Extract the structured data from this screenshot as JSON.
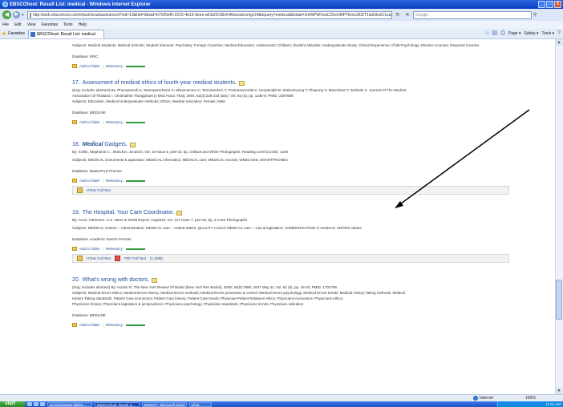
{
  "window": {
    "title": "EBSCOhost: Result List: medical - Windows Internet Explorer",
    "min": "_",
    "max": "□",
    "close": "x"
  },
  "address": {
    "url": "http://web.ebscohost.com/ehost/resultsadvanced?vid=13&hid=9&sid=b7025ef0-2215-4b13-9eee-a51b0316b%40sessionmgr14&bquery=medical&bdata=JmRiPWVoaCZ0eXBlPTEmc2l0ZT1laG9zdC1saXZl",
    "search_placeholder": "Google",
    "back": "◀",
    "forward": "▶",
    "refresh": "↻",
    "stop": "✕"
  },
  "menu": [
    "File",
    "Edit",
    "View",
    "Favorites",
    "Tools",
    "Help"
  ],
  "favorites": {
    "label": "Favorites",
    "tab_label": "EBSCOhost: Result List: medical",
    "commands": [
      "Page ▾",
      "Safety ▾",
      "Tools ▾"
    ]
  },
  "results": [
    {
      "id": "prev",
      "lines": [
        "Subjects: Medical Students; Medical Schools; Student Interests; Psychiatry; Foreign Countries; Medical Education; Adolescents; Children; Student Attitudes; Undergraduate Study; Clinical Experience; Child Psychology; Elective Courses; Required Courses",
        "Database: ERIC"
      ],
      "add_folder": "Add to folder",
      "relevancy": "Relevancy:"
    },
    {
      "id": "r17",
      "number": "17.",
      "title": "Assessment of medical ethics of fourth-year medical students.",
      "lines": [
        "(Eng; includes abstract) By: Phaosavasdi S; Taneepanichskul S; Wilasrusmee C; Tannirandorn Y; Pruksananonda K; Uerpairojkit B; Sittisomwong T; Phupong V; Manchana T; Wisitsak S. Journal Of The Medical",
        "Association Of Thailand = Chotmaihet Thangphaet [J Med Assoc Thai], 2004; 82(3):228-233 (abs); Vol. 82 (3), pp. 1235-6; PMID: 2387888",
        "Subjects: Education, Medical Undergraduate methods; Ethics, Medical education; Female; Male",
        "Database: MEDLINE"
      ],
      "add_folder": "Add to folder",
      "relevancy": "Relevancy:"
    },
    {
      "id": "r18",
      "number": "18.",
      "title_bold": "Medical",
      "title": " Gadgets.",
      "lines": [
        "By: Krafts, Stephanie C.; Sketcher, Jun2010, Vol. 18 Issue 5, p38-42, 5p, 3 Black and White Photographs; Reading Level (Lexile): 1440",
        "Subjects: MEDICAL instruments & apparatus; MEDICAL informatics; MEDICAL care; MEDICAL records; WEBCAMS; SMARTPHONES",
        "Database: MasterFILE Premier"
      ],
      "add_folder": "Add to folder",
      "relevancy": "Relevancy:",
      "fulltext": [
        "HTML Full Text"
      ]
    },
    {
      "id": "r19",
      "number": "19.",
      "title": "The Hospital, Your Care Coordinator.",
      "lines": [
        "By: Arnst, Catherine. U.S. News & World Report, Aug2010, Vol. 147 Issue 7, p22-30, 5p, 3 Color Photographs",
        "Subjects: MEDICAL centers -- Administration; MEDICAL care -- United States; QUALITY control; MEDICAL care -- Law & legislation; COMMUNICATION in medicine; UNITED States",
        "Database: Academic Search Premier"
      ],
      "add_folder": "Add to folder",
      "relevancy": "Relevancy:",
      "fulltext": [
        "HTML Full Text",
        "PDF Full Text",
        "(1.2MB)"
      ]
    },
    {
      "id": "r20",
      "number": "20.",
      "title": "What's wrong with doctors.",
      "lines": [
        "(Eng; includes abstract) By: Horton R, The New York Review Of Books [New York Rev Books], 2009; 46(9):7886; 2007 May 31; Vol. 54 (9), pp. 16-20; PMID: 1702799",
        "Subjects: Medical Errors ethics; Medical Errors history; Medical Errors methods; Medical Errors prevention & control; Medical Errors psychology; Medical Errors trends; Medical History Taking methods; Medical",
        "History Taking standards; Patient Care economics; Patient Care history; Patient Care trends; Physician-Patient Relations ethics; Physicians economics; Physicians ethics;",
        "Physicians history; Physicians legislation & jurisprudence; Physicians psychology; Physicians standards; Physicians trends; Physicians utilization",
        "Database: MEDLINE"
      ],
      "add_folder": "Add to folder",
      "relevancy": "Relevancy:"
    }
  ],
  "status": {
    "zone": "Internet",
    "zoom": "100%"
  },
  "taskbar": {
    "start": "start",
    "items": [
      "Universitetska bibliot...",
      "EBSCOhost: Result Li...",
      "EBSCO - Microsoft Word",
      "Chat"
    ],
    "clock": "11:51 AM"
  }
}
